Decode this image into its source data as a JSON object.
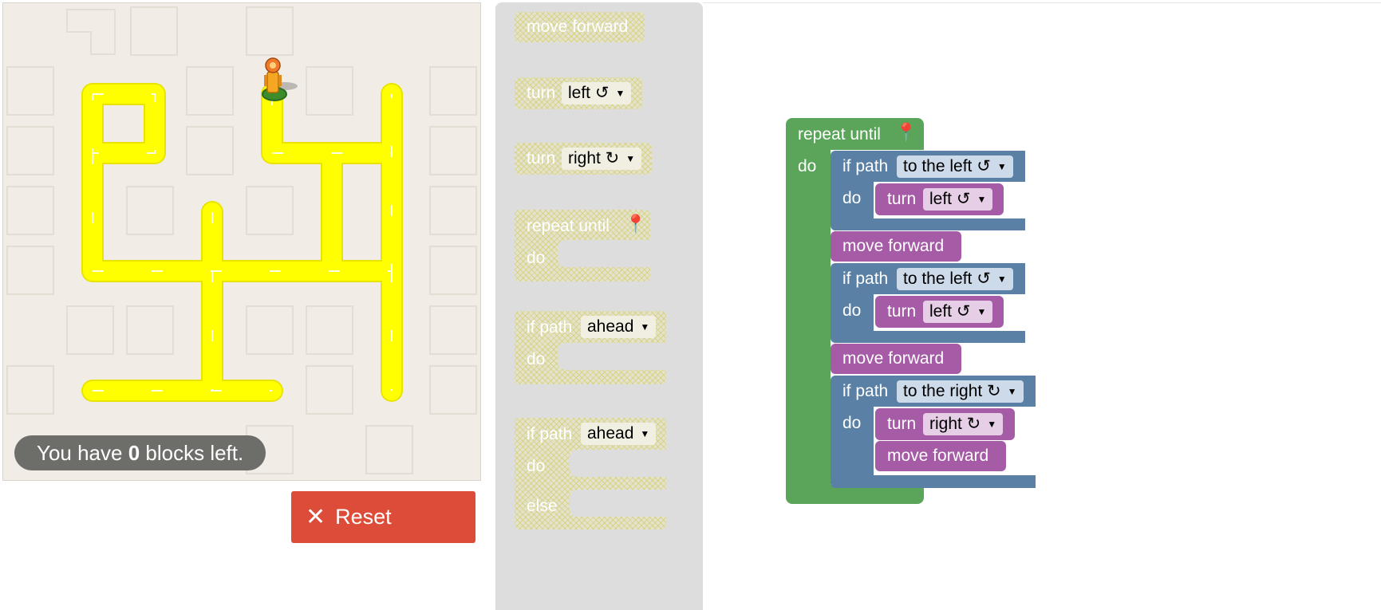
{
  "capacity": {
    "prefix": "You have ",
    "count": "0",
    "suffix": " blocks left."
  },
  "reset": {
    "icon": "✕",
    "label": "Reset"
  },
  "toolbox": {
    "move_forward": "move forward",
    "turn_left": {
      "label": "turn",
      "dir": "left ↺"
    },
    "turn_right": {
      "label": "turn",
      "dir": "right ↻"
    },
    "repeat": {
      "label": "repeat until",
      "do": "do"
    },
    "if_path": {
      "label": "if path",
      "dir": "ahead",
      "do": "do"
    },
    "if_else": {
      "label": "if path",
      "dir": "ahead",
      "do": "do",
      "else": "else"
    }
  },
  "program": {
    "repeat_label": "repeat until",
    "do": "do",
    "if1": {
      "label": "if path",
      "dir": "to the left ↺",
      "do": "do",
      "turn": "turn",
      "turn_dir": "left ↺"
    },
    "move1": "move forward",
    "if2": {
      "label": "if path",
      "dir": "to the left ↺",
      "do": "do",
      "turn": "turn",
      "turn_dir": "left ↺"
    },
    "move2": "move forward",
    "if3": {
      "label": "if path",
      "dir": "to the right ↻",
      "do": "do",
      "turn": "turn",
      "turn_dir": "right ↻",
      "move": "move forward"
    }
  },
  "colors": {
    "loop": "#5ba55b",
    "logic": "#5b80a5",
    "movement": "#a55ba5",
    "reset": "#dd4b39",
    "path": "#ffff00"
  }
}
